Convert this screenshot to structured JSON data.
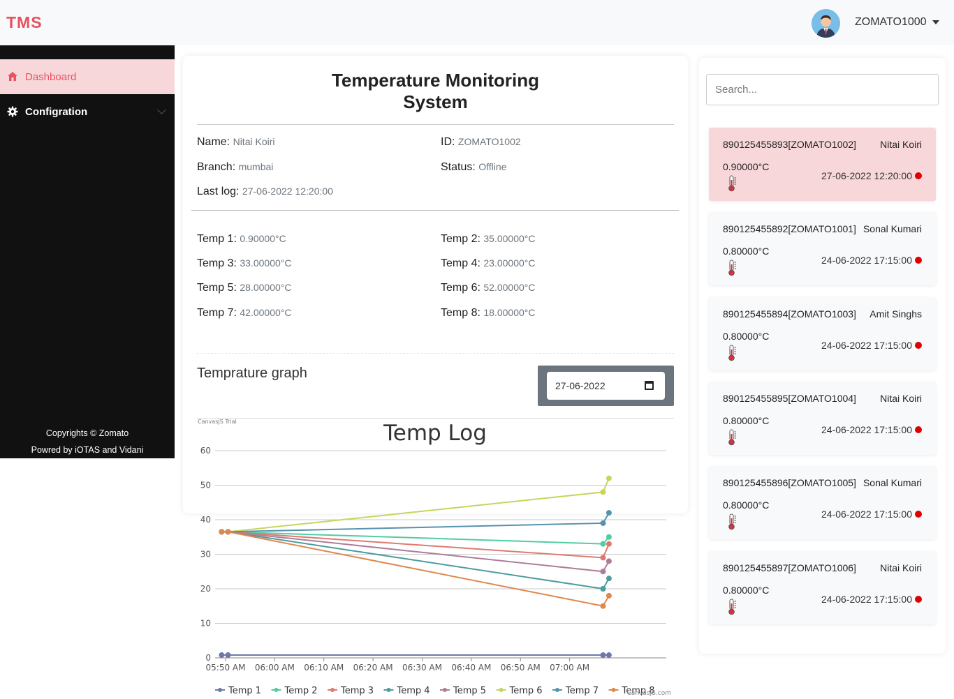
{
  "header": {
    "brand": "TMS",
    "user_name": "ZOMATO1000"
  },
  "sidebar": {
    "items": [
      {
        "label": "Dashboard",
        "icon": "home-icon"
      },
      {
        "label": "Configration",
        "icon": "gear-icon"
      }
    ],
    "footer_copyright": "Copyrights © Zomato",
    "footer_powered": "Powred by iOTAS and Vidani"
  },
  "main": {
    "title_line1": "Temperature Monitoring",
    "title_line2": "System",
    "name_label": "Name:",
    "name_value": "Nitai Koiri",
    "id_label": "ID:",
    "id_value": "ZOMATO1002",
    "branch_label": "Branch:",
    "branch_value": "mumbai",
    "status_label": "Status:",
    "status_value": "Offline",
    "lastlog_label": "Last log:",
    "lastlog_value": "27-06-2022 12:20:00",
    "temps": [
      {
        "label": "Temp 1:",
        "value": "0.90000°C"
      },
      {
        "label": "Temp 2:",
        "value": "35.00000°C"
      },
      {
        "label": "Temp 3:",
        "value": "33.00000°C"
      },
      {
        "label": "Temp 4:",
        "value": "23.00000°C"
      },
      {
        "label": "Temp 5:",
        "value": "28.00000°C"
      },
      {
        "label": "Temp 6:",
        "value": "52.00000°C"
      },
      {
        "label": "Temp 7:",
        "value": "42.00000°C"
      },
      {
        "label": "Temp 8:",
        "value": "18.00000°C"
      }
    ],
    "graph_title": "Temprature graph",
    "date_value": "27-06-2022"
  },
  "chart_data": {
    "type": "line",
    "title": "Temp Log",
    "trial_text": "CanvasJS Trial",
    "credit_text": "CanvasJS.com",
    "ylim": [
      0,
      60
    ],
    "yticks": [
      0,
      10,
      20,
      30,
      40,
      50,
      60
    ],
    "xlim_minutes": [
      0,
      80
    ],
    "xtick_labels": [
      "05:50 AM",
      "06:00 AM",
      "06:10 AM",
      "06:20 AM",
      "06:30 AM",
      "06:40 AM",
      "06:50 AM",
      "07:00 AM"
    ],
    "grid": true,
    "legend_position": "bottom",
    "series": [
      {
        "name": "Temp 1",
        "color": "#6d78ad",
        "points": [
          [
            -0.8,
            0.8
          ],
          [
            0.5,
            0.8
          ],
          [
            76.8,
            0.8
          ],
          [
            78,
            0.8
          ]
        ]
      },
      {
        "name": "Temp 2",
        "color": "#51cda0",
        "points": [
          [
            -0.8,
            36.5
          ],
          [
            0.5,
            36.5
          ],
          [
            76.8,
            33
          ],
          [
            78,
            35
          ]
        ]
      },
      {
        "name": "Temp 3",
        "color": "#df7970",
        "points": [
          [
            -0.8,
            36.5
          ],
          [
            0.5,
            36.5
          ],
          [
            76.8,
            29
          ],
          [
            78,
            33
          ]
        ]
      },
      {
        "name": "Temp 4",
        "color": "#4c9ca0",
        "points": [
          [
            -0.8,
            36.5
          ],
          [
            0.5,
            36.5
          ],
          [
            76.8,
            20
          ],
          [
            78,
            23
          ]
        ]
      },
      {
        "name": "Temp 5",
        "color": "#ae7d99",
        "points": [
          [
            -0.8,
            36.5
          ],
          [
            0.5,
            36.5
          ],
          [
            76.8,
            25
          ],
          [
            78,
            28
          ]
        ]
      },
      {
        "name": "Temp 6",
        "color": "#c9d45c",
        "points": [
          [
            -0.8,
            36.5
          ],
          [
            0.5,
            36.5
          ],
          [
            76.8,
            48
          ],
          [
            78,
            52
          ]
        ]
      },
      {
        "name": "Temp 7",
        "color": "#5592ad",
        "points": [
          [
            -0.8,
            36.5
          ],
          [
            0.5,
            36.5
          ],
          [
            76.8,
            39
          ],
          [
            78,
            42
          ]
        ]
      },
      {
        "name": "Temp 8",
        "color": "#df874d",
        "points": [
          [
            -0.8,
            36.5
          ],
          [
            0.5,
            36.5
          ],
          [
            76.8,
            15
          ],
          [
            78,
            18
          ]
        ]
      }
    ]
  },
  "right": {
    "search_placeholder": "Search...",
    "devices": [
      {
        "id_text": "890125455893[ZOMATO1002]",
        "name": "Nitai Koiri",
        "temp": "0.90000°C",
        "time": "27-06-2022 12:20:00"
      },
      {
        "id_text": "890125455892[ZOMATO1001]",
        "name": "Sonal Kumari",
        "temp": "0.80000°C",
        "time": "24-06-2022 17:15:00"
      },
      {
        "id_text": "890125455894[ZOMATO1003]",
        "name": "Amit Singhs",
        "temp": "0.80000°C",
        "time": "24-06-2022 17:15:00"
      },
      {
        "id_text": "890125455895[ZOMATO1004]",
        "name": "Nitai Koiri",
        "temp": "0.80000°C",
        "time": "24-06-2022 17:15:00"
      },
      {
        "id_text": "890125455896[ZOMATO1005]",
        "name": "Sonal Kumari",
        "temp": "0.80000°C",
        "time": "24-06-2022 17:15:00"
      },
      {
        "id_text": "890125455897[ZOMATO1006]",
        "name": "Nitai Koiri",
        "temp": "0.80000°C",
        "time": "24-06-2022 17:15:00"
      }
    ],
    "status_color": "#e00000"
  }
}
